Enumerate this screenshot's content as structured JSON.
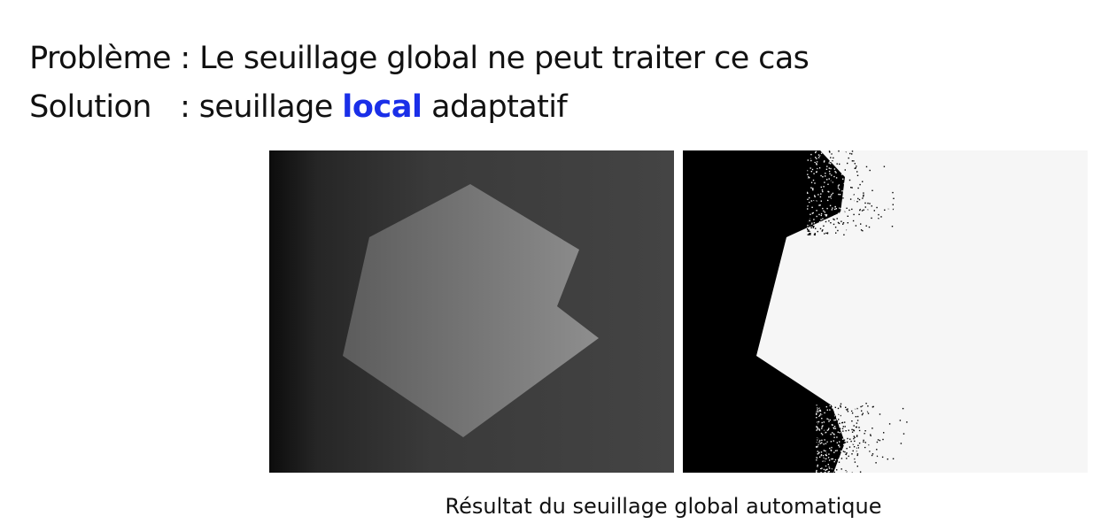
{
  "text": {
    "line1": {
      "label": "Problème",
      "separator": " : ",
      "content": "Le seuillage global ne peut traiter ce cas"
    },
    "line2": {
      "label": "Solution",
      "separator": ": ",
      "before": "seuillage ",
      "keyword": "local",
      "after": " adaptatif",
      "keyword_color": "#1a2fe8"
    },
    "caption": "Résultat du seuillage global automatique"
  },
  "figures": {
    "left": {
      "description_icon": "gradient-polygon-image",
      "background_colors": [
        "#0c0c0c",
        "#444444"
      ]
    },
    "right": {
      "description_icon": "thresholded-binary-image",
      "background_colors": [
        "#000000",
        "#f6f6f6"
      ]
    }
  }
}
